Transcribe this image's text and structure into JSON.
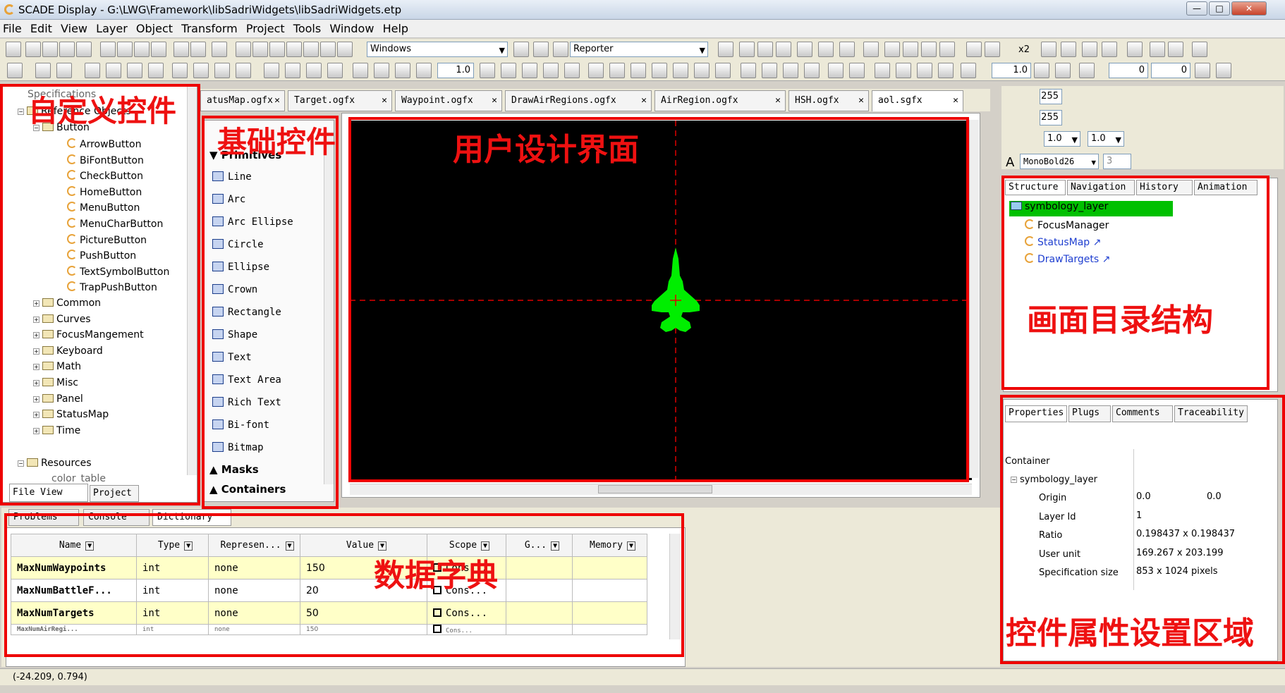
{
  "window": {
    "title": "SCADE Display - G:\\LWG\\Framework\\libSadriWidgets\\libSadriWidgets.etp"
  },
  "menu": [
    "File",
    "Edit",
    "View",
    "Layer",
    "Object",
    "Transform",
    "Project",
    "Tools",
    "Window",
    "Help"
  ],
  "toolbar": {
    "windows_combo": "Windows",
    "reporter_combo": "Reporter",
    "zoom_label": "x2",
    "line_width": "1.0",
    "rotate_value": "1.0",
    "offset_x": "0",
    "offset_y": "0"
  },
  "left_tree": {
    "partial_top": "Specifications",
    "reference_objects": "Reference Objects",
    "button_folder": "Button",
    "buttons": [
      "ArrowButton",
      "BiFontButton",
      "CheckButton",
      "HomeButton",
      "MenuButton",
      "MenuCharButton",
      "PictureButton",
      "PushButton",
      "TextSymbolButton",
      "TrapPushButton"
    ],
    "folders": [
      "Common",
      "Curves",
      "FocusMangement",
      "Keyboard",
      "Math",
      "Misc",
      "Panel",
      "StatusMap",
      "Time"
    ],
    "resources": "Resources",
    "partial_bottom": "color_table",
    "tab_file_view": "File View",
    "tab_project": "Project"
  },
  "doc_tabs": [
    "atusMap.ogfx",
    "Target.ogfx",
    "Waypoint.ogfx",
    "DrawAirRegions.ogfx",
    "AirRegion.ogfx",
    "HSH.ogfx",
    "aol.sgfx"
  ],
  "primitives": {
    "header": "Primitives",
    "items": [
      "Line",
      "Arc",
      "Arc Ellipse",
      "Circle",
      "Ellipse",
      "Crown",
      "Rectangle",
      "Shape",
      "Text",
      "Text Area",
      "Rich Text",
      "Bi-font",
      "Bitmap"
    ],
    "masks": "Masks",
    "containers": "Containers"
  },
  "annotations": {
    "custom_widgets": "自定义控件",
    "basic_widgets": "基础控件",
    "design_ui": "用户设计界面",
    "screen_tree": "画面目录结构",
    "data_dict": "数据字典",
    "props_area": "控件属性设置区域"
  },
  "colors": {
    "annotation_red": "#ee0000",
    "aircraft": "#00ee00",
    "highlight_layer": "#00c000",
    "canvas": "#000000"
  },
  "right_top": {
    "color_a": "255",
    "color_b": "255",
    "w1": "1.0",
    "w2": "1.0",
    "font": "MonoBold26",
    "font_size": "3"
  },
  "structure": {
    "tabs": [
      "Structure",
      "Navigation",
      "History",
      "Animation"
    ],
    "root": "symbology_layer",
    "children": [
      "FocusManager",
      "StatusMap",
      "DrawTargets"
    ]
  },
  "properties": {
    "tabs": [
      "Properties",
      "Plugs",
      "Comments",
      "Traceability"
    ],
    "container": "Container",
    "layer": "symbology_layer",
    "rows": [
      {
        "name": "Origin",
        "v1": "0.0",
        "v2": "0.0"
      },
      {
        "name": "Layer Id",
        "v1": "1",
        "v2": ""
      },
      {
        "name": "Ratio",
        "v1": "0.198437 x 0.198437",
        "v2": ""
      },
      {
        "name": "User unit",
        "v1": "169.267 x 203.199",
        "v2": ""
      },
      {
        "name": "Specification size",
        "v1": "853 x 1024 pixels",
        "v2": ""
      }
    ]
  },
  "bottom_tabs": [
    "Problems",
    "Console",
    "Dictionary"
  ],
  "dictionary": {
    "columns": [
      "Name",
      "Type",
      "Represen...",
      "Value",
      "Scope",
      "G...",
      "Memory"
    ],
    "rows": [
      {
        "name": "MaxNumWaypoints",
        "type": "int",
        "rep": "none",
        "value": "150",
        "scope": "Cons..."
      },
      {
        "name": "MaxNumBattleF...",
        "type": "int",
        "rep": "none",
        "value": "20",
        "scope": "Cons..."
      },
      {
        "name": "MaxNumTargets",
        "type": "int",
        "rep": "none",
        "value": "50",
        "scope": "Cons..."
      },
      {
        "name": "MaxNumAirRegi...",
        "type": "int",
        "rep": "none",
        "value": "150",
        "scope": "Cons..."
      }
    ]
  },
  "status": {
    "coords": "(-24.209, 0.794)"
  }
}
